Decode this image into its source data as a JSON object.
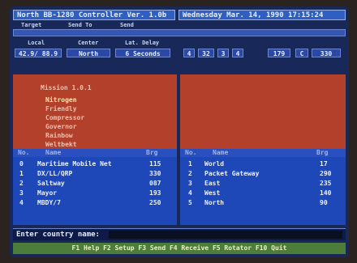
{
  "title_bar": {
    "left": "North BB-1280 Controller  Ver. 1.0b",
    "right": "Wednesday  Mar. 14, 1990   17:15:24"
  },
  "header_labels": {
    "target": "Target",
    "send_to": "Send To",
    "send": "Send",
    "local": "Local",
    "center": "Center",
    "lat_delay": "Lat. Delay"
  },
  "status_values": {
    "local": "42.9/ 88.9",
    "center": "North",
    "delay": "6 Seconds",
    "v1": "4",
    "v2": "32",
    "v3": "3",
    "v4": "4",
    "v5": "179",
    "v6": "C",
    "v7": "330"
  },
  "left_panel": {
    "rows": [
      "Mission 1.0.1",
      "Nitrogen",
      "Friendly",
      "Compressor",
      "Governor",
      "Rainbow",
      "Weltbekt"
    ]
  },
  "left_list": {
    "columns": [
      "No.",
      "Name",
      "Brg"
    ],
    "rows": [
      {
        "no": "0",
        "name": "Maritime Mobile Net",
        "val": "115"
      },
      {
        "no": "1",
        "name": "DX/LL/QRP",
        "val": "330"
      },
      {
        "no": "2",
        "name": "Saltway",
        "val": "087"
      },
      {
        "no": "3",
        "name": "Mayor",
        "val": "193"
      },
      {
        "no": "4",
        "name": "MBDY/7",
        "val": "250"
      }
    ]
  },
  "right_list": {
    "columns": [
      "No.",
      "Name",
      "Brg"
    ],
    "rows": [
      {
        "no": "1",
        "name": "World",
        "val": "17"
      },
      {
        "no": "2",
        "name": "Packet Gateway",
        "val": "290"
      },
      {
        "no": "3",
        "name": "East",
        "val": "235"
      },
      {
        "no": "4",
        "name": "West",
        "val": "140"
      },
      {
        "no": "5",
        "name": "North",
        "val": "90"
      }
    ]
  },
  "prompt": {
    "label": "Enter country name:"
  },
  "footer": "F1 Help  F2 Setup  F3 Send  F4 Receive  F5 Rotator  F10 Quit"
}
